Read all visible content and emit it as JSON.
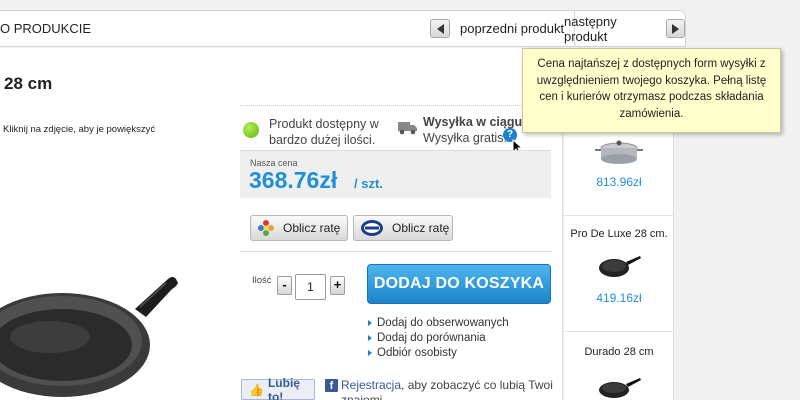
{
  "topbar": {
    "breadcrumb": "O PRODUKCIE",
    "prev_label": "poprzedni produkt",
    "next_label": "następny produkt"
  },
  "product": {
    "title": "28 cm",
    "image_hint": "Kliknij na zdjęcie, aby je powiększyć"
  },
  "availability": {
    "status": "Produkt dostępny w bardzo dużej ilości.",
    "shipping_title": "Wysyłka w ciągu 3",
    "shipping_free": "Wysyłka gratis!",
    "help_glyph": "?"
  },
  "price": {
    "label": "Nasza cena",
    "value": "368.76zł",
    "unit": "/ szt."
  },
  "installments": [
    {
      "label": "Oblicz ratę",
      "icon": "flower-logo-icon"
    },
    {
      "label": "Oblicz ratę",
      "icon": "zagiel-logo-icon"
    }
  ],
  "quantity": {
    "label": "Ilość",
    "value": "1",
    "minus": "-",
    "plus": "+"
  },
  "cart": {
    "add_label": "DODAJ DO KOSZYKA"
  },
  "links": [
    "Dodaj do obserwowanych",
    "Dodaj do porównania",
    "Odbiór osobisty"
  ],
  "social": {
    "like_label": "Lubię to!",
    "fb_glyph": "f",
    "register_link": "Rejestracja",
    "register_text": ", aby zobaczyć co lubią Twoi znajomi."
  },
  "sidebar": {
    "items": [
      {
        "name": "",
        "price": "813.96zł"
      },
      {
        "name": "Pro De Luxe 28 cm.",
        "price": "419.16zł"
      },
      {
        "name": "Durado 28 cm",
        "price": ""
      }
    ]
  },
  "tooltip": {
    "text": "Cena najtańszej z dostępnych form wysyłki z uwzględnieniem twojego koszyka. Pełną listę cen i kurierów otrzymasz podczas składania zamówienia."
  },
  "colors": {
    "accent_blue": "#1f8fd6",
    "cart_button": "#1b84c9",
    "tooltip_bg": "#ffffcc",
    "available_green": "#5cb800"
  }
}
